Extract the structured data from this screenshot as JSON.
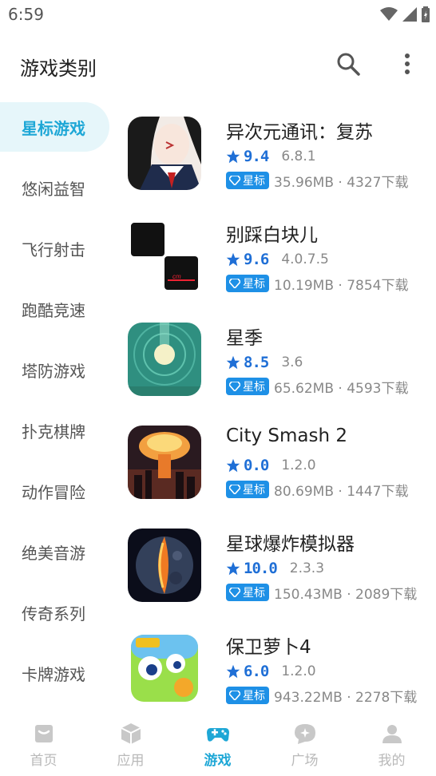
{
  "status_bar": {
    "time": "6:59"
  },
  "app_bar": {
    "title": "游戏类别",
    "icons": [
      "search-icon",
      "more-vertical-icon"
    ]
  },
  "categories": [
    {
      "label": "星标游戏",
      "active": true
    },
    {
      "label": "悠闲益智",
      "active": false
    },
    {
      "label": "飞行射击",
      "active": false
    },
    {
      "label": "跑酷竞速",
      "active": false
    },
    {
      "label": "塔防游戏",
      "active": false
    },
    {
      "label": "扑克棋牌",
      "active": false
    },
    {
      "label": "动作冒险",
      "active": false
    },
    {
      "label": "绝美音游",
      "active": false
    },
    {
      "label": "传奇系列",
      "active": false
    },
    {
      "label": "卡牌游戏",
      "active": false
    }
  ],
  "apps": [
    {
      "name": "异次元通讯：复苏",
      "rating": "9.4",
      "version": "6.8.1",
      "badge": "星标",
      "meta": "35.96MB · 4327下载",
      "icon": "anime-girl-icon"
    },
    {
      "name": "别踩白块儿",
      "rating": "9.6",
      "version": "4.0.7.5",
      "badge": "星标",
      "meta": "10.19MB · 7854下载",
      "icon": "piano-tiles-icon"
    },
    {
      "name": "星季",
      "rating": "8.5",
      "version": "3.6",
      "badge": "星标",
      "meta": "65.62MB · 4593下载",
      "icon": "glowing-orb-icon"
    },
    {
      "name": "City Smash 2",
      "rating": "0.0",
      "version": "1.2.0",
      "badge": "星标",
      "meta": "80.69MB · 1447下载",
      "icon": "mushroom-cloud-icon"
    },
    {
      "name": "星球爆炸模拟器",
      "rating": "10.0",
      "version": "2.3.3",
      "badge": "星标",
      "meta": "150.43MB · 2089下载",
      "icon": "exploding-planet-icon"
    },
    {
      "name": "保卫萝卜4",
      "rating": "6.0",
      "version": "1.2.0",
      "badge": "星标",
      "meta": "943.22MB · 2278下载",
      "icon": "carrot-game-icon"
    }
  ],
  "bottom_nav": [
    {
      "label": "首页",
      "icon": "home-icon",
      "active": false
    },
    {
      "label": "应用",
      "icon": "cube-icon",
      "active": false
    },
    {
      "label": "游戏",
      "icon": "gamepad-icon",
      "active": true
    },
    {
      "label": "广场",
      "icon": "chat-bubble-icon",
      "active": false
    },
    {
      "label": "我的",
      "icon": "user-icon",
      "active": false
    }
  ],
  "colors": {
    "accent": "#1ea7d6",
    "rating": "#1f6fd6",
    "badge": "#1e90e6",
    "active_bg": "#e6f6fa"
  }
}
